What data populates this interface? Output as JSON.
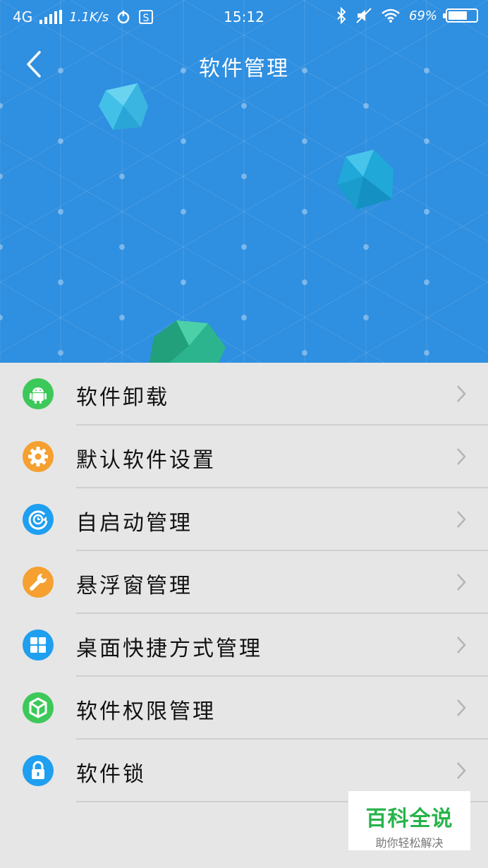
{
  "status_bar": {
    "network": "4G",
    "speed": "1.1K/s",
    "time": "15:12",
    "battery": "69%",
    "battery_fraction": 0.69
  },
  "header": {
    "title": "软件管理"
  },
  "menu": {
    "items": [
      {
        "label": "软件卸载",
        "icon": "android-icon",
        "color": "#3dc85a"
      },
      {
        "label": "默认软件设置",
        "icon": "gear-icon",
        "color": "#f5a030"
      },
      {
        "label": "自启动管理",
        "icon": "auto-start-icon",
        "color": "#1f9ff0"
      },
      {
        "label": "悬浮窗管理",
        "icon": "wrench-icon",
        "color": "#f5a030"
      },
      {
        "label": "桌面快捷方式管理",
        "icon": "grid-icon",
        "color": "#1f9ff0"
      },
      {
        "label": "软件权限管理",
        "icon": "shield-icon",
        "color": "#3dc85a"
      },
      {
        "label": "软件锁",
        "icon": "lock-icon",
        "color": "#1f9ff0"
      }
    ]
  },
  "watermark": {
    "main": "百科全说",
    "sub": "助你轻松解决"
  }
}
